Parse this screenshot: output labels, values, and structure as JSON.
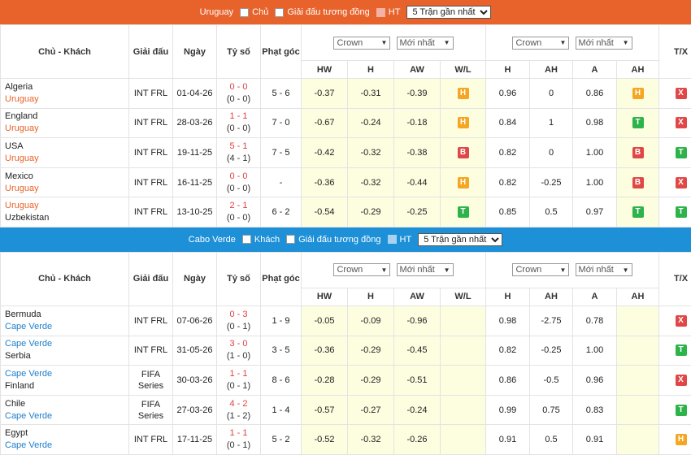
{
  "section1": {
    "team": "Uruguay",
    "opt_home": "Chủ",
    "opt_same": "Giải đấu tương đồng",
    "opt_ht": "HT",
    "select": "5 Trận gần nhất",
    "headers": {
      "match": "Chủ - Khách",
      "league": "Giải đấu",
      "date": "Ngày",
      "score": "Tỷ số",
      "corner": "Phạt góc",
      "txh": "T/X",
      "hw": "HW",
      "h": "H",
      "aw": "AW",
      "wl": "W/L",
      "h2": "H",
      "ah": "AH",
      "a": "A",
      "ah2": "AH"
    },
    "sel1": "Crown",
    "sel2": "Mới nhất",
    "sel3": "Crown",
    "sel4": "Mới nhất",
    "rows": [
      {
        "home": "Algeria",
        "away": "Uruguay",
        "league": "INT FRL",
        "date": "01-04-26",
        "score": "0 - 0",
        "ht": "(0 - 0)",
        "corner": "5 - 6",
        "hw": "-0.37",
        "h": "-0.31",
        "aw": "-0.39",
        "wl": "H",
        "h2": "0.96",
        "ah": "0",
        "a": "0.86",
        "ah2": "H",
        "tx": "X"
      },
      {
        "home": "England",
        "away": "Uruguay",
        "league": "INT FRL",
        "date": "28-03-26",
        "score": "1 - 1",
        "ht": "(0 - 0)",
        "corner": "7 - 0",
        "hw": "-0.67",
        "h": "-0.24",
        "aw": "-0.18",
        "wl": "H",
        "h2": "0.84",
        "ah": "1",
        "a": "0.98",
        "ah2": "T",
        "tx": "X"
      },
      {
        "home": "USA",
        "away": "Uruguay",
        "league": "INT FRL",
        "date": "19-11-25",
        "score": "5 - 1",
        "ht": "(4 - 1)",
        "corner": "7 - 5",
        "hw": "-0.42",
        "h": "-0.32",
        "aw": "-0.38",
        "wl": "B",
        "h2": "0.82",
        "ah": "0",
        "a": "1.00",
        "ah2": "B",
        "tx": "T"
      },
      {
        "home": "Mexico",
        "away": "Uruguay",
        "league": "INT FRL",
        "date": "16-11-25",
        "score": "0 - 0",
        "ht": "(0 - 0)",
        "corner": "-",
        "hw": "-0.36",
        "h": "-0.32",
        "aw": "-0.44",
        "wl": "H",
        "h2": "0.82",
        "ah": "-0.25",
        "a": "1.00",
        "ah2": "B",
        "tx": "X"
      },
      {
        "home": "Uruguay",
        "away": "Uzbekistan",
        "league": "INT FRL",
        "date": "13-10-25",
        "score": "2 - 1",
        "ht": "(0 - 0)",
        "corner": "6 - 2",
        "hw": "-0.54",
        "h": "-0.29",
        "aw": "-0.25",
        "wl": "T",
        "h2": "0.85",
        "ah": "0.5",
        "a": "0.97",
        "ah2": "T",
        "tx": "T"
      }
    ]
  },
  "section2": {
    "team": "Cabo Verde",
    "opt_home": "Khách",
    "opt_same": "Giải đấu tương đồng",
    "opt_ht": "HT",
    "select": "5 Trận gần nhất",
    "headers": {
      "match": "Chủ - Khách",
      "league": "Giải đấu",
      "date": "Ngày",
      "score": "Tỷ số",
      "corner": "Phạt góc",
      "txh": "T/X",
      "hw": "HW",
      "h": "H",
      "aw": "AW",
      "wl": "W/L",
      "h2": "H",
      "ah": "AH",
      "a": "A",
      "ah2": "AH"
    },
    "sel1": "Crown",
    "sel2": "Mới nhất",
    "sel3": "Crown",
    "sel4": "Mới nhất",
    "rows": [
      {
        "home": "Bermuda",
        "away": "Cape Verde",
        "league": "INT FRL",
        "league2": "",
        "date": "07-06-26",
        "score": "0 - 3",
        "ht": "(0 - 1)",
        "corner": "1 - 9",
        "hw": "-0.05",
        "h": "-0.09",
        "aw": "-0.96",
        "wl": "",
        "h2": "0.98",
        "ah": "-2.75",
        "a": "0.78",
        "ah2": "",
        "tx": "X"
      },
      {
        "home": "Cape Verde",
        "away": "Serbia",
        "league": "INT FRL",
        "league2": "",
        "date": "31-05-26",
        "score": "3 - 0",
        "ht": "(1 - 0)",
        "corner": "3 - 5",
        "hw": "-0.36",
        "h": "-0.29",
        "aw": "-0.45",
        "wl": "",
        "h2": "0.82",
        "ah": "-0.25",
        "a": "1.00",
        "ah2": "",
        "tx": "T"
      },
      {
        "home": "Cape Verde",
        "away": "Finland",
        "league": "FIFA",
        "league2": "Series",
        "date": "30-03-26",
        "score": "1 - 1",
        "ht": "(0 - 1)",
        "corner": "8 - 6",
        "hw": "-0.28",
        "h": "-0.29",
        "aw": "-0.51",
        "wl": "",
        "h2": "0.86",
        "ah": "-0.5",
        "a": "0.96",
        "ah2": "",
        "tx": "X"
      },
      {
        "home": "Chile",
        "away": "Cape Verde",
        "league": "FIFA",
        "league2": "Series",
        "date": "27-03-26",
        "score": "4 - 2",
        "ht": "(1 - 2)",
        "corner": "1 - 4",
        "hw": "-0.57",
        "h": "-0.27",
        "aw": "-0.24",
        "wl": "",
        "h2": "0.99",
        "ah": "0.75",
        "a": "0.83",
        "ah2": "",
        "tx": "T"
      },
      {
        "home": "Egypt",
        "away": "Cape Verde",
        "league": "INT FRL",
        "league2": "",
        "date": "17-11-25",
        "score": "1 - 1",
        "ht": "(0 - 1)",
        "corner": "5 - 2",
        "hw": "-0.52",
        "h": "-0.32",
        "aw": "-0.26",
        "wl": "",
        "h2": "0.91",
        "ah": "0.5",
        "a": "0.91",
        "ah2": "",
        "tx": "H"
      }
    ]
  }
}
